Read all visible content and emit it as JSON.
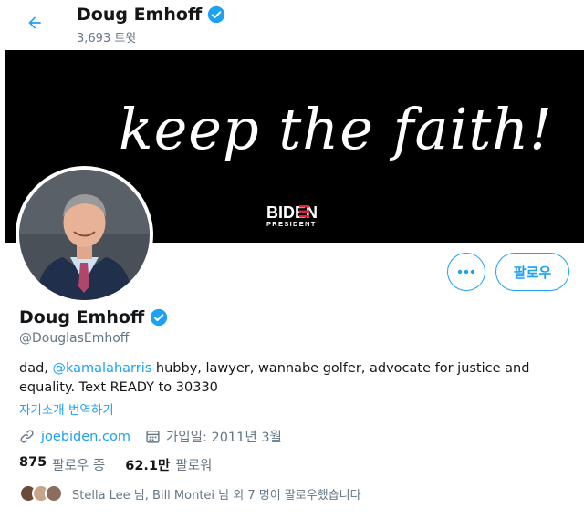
{
  "header": {
    "name": "Doug Emhoff",
    "tweet_count": "3,693 트윗"
  },
  "banner": {
    "script_text": "keep the faith!",
    "logo_main": "BIDEN",
    "logo_sub": "PRESIDENT"
  },
  "actions": {
    "follow_label": "팔로우"
  },
  "profile": {
    "name": "Doug Emhoff",
    "handle": "@DouglasEmhoff",
    "bio_prefix": "dad, ",
    "bio_mention": "@kamalaharris",
    "bio_suffix": " hubby, lawyer, wannabe golfer, advocate for justice and equality. Text READY to 30330",
    "translate_label": "자기소개 번역하기",
    "website": "joebiden.com",
    "joined": "가입일: 2011년 3월"
  },
  "stats": {
    "following_count": "875",
    "following_label": "팔로우 중",
    "followers_count": "62.1만",
    "followers_label": "팔로워"
  },
  "followed_by": {
    "text": "Stella Lee 님, Bill Montei 님 외 7 명이 팔로우했습니다"
  },
  "colors": {
    "accent": "#1da1f2",
    "secondary_text": "#657786",
    "primary_text": "#14171a",
    "banner_bg": "#000000"
  },
  "icons": [
    "back-arrow-icon",
    "verified-badge-icon",
    "more-dots-icon",
    "link-icon",
    "calendar-icon"
  ]
}
